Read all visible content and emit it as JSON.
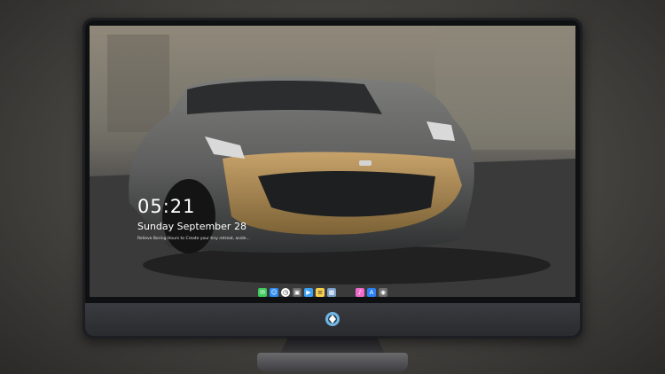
{
  "lockscreen": {
    "time": "05:21",
    "date": "Sunday September  28",
    "tagline": "Relieve Boring Hours to Create your tiny retreat, aside..."
  },
  "dock": {
    "icons": [
      {
        "name": "messages-icon",
        "color": "#3ecb5c"
      },
      {
        "name": "finder-icon",
        "color": "#2d8bf0"
      },
      {
        "name": "clock-icon",
        "color": "#ffffff"
      },
      {
        "name": "photos-app-icon",
        "color": "#6a6a6a"
      },
      {
        "name": "video-icon",
        "color": "#3ba0f5"
      },
      {
        "name": "notes-icon",
        "color": "#f6d04d"
      },
      {
        "name": "preview-icon",
        "color": "#7aa0c8"
      },
      {
        "name": "itunes-icon",
        "color": "#f06acb"
      },
      {
        "name": "app-store-icon",
        "color": "#2a7ff3"
      },
      {
        "name": "camera-icon",
        "color": "#6e6e6e"
      }
    ]
  }
}
